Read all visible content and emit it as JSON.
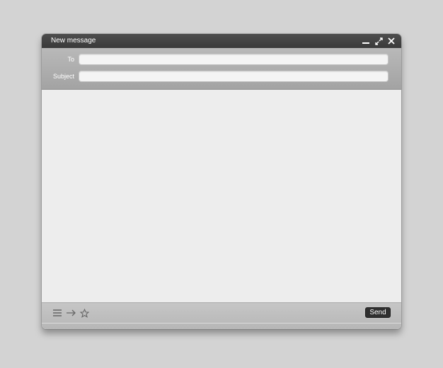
{
  "window": {
    "title": "New message"
  },
  "fields": {
    "to_label": "To",
    "to_value": "",
    "subject_label": "Subject",
    "subject_value": ""
  },
  "body": {
    "value": ""
  },
  "footer": {
    "send_label": "Send",
    "icons": [
      "menu-icon",
      "arrow-right-icon",
      "star-icon"
    ]
  },
  "colors": {
    "titlebar": "#404040",
    "header": "#ababab",
    "body": "#ededed",
    "send": "#2f2f2f"
  }
}
